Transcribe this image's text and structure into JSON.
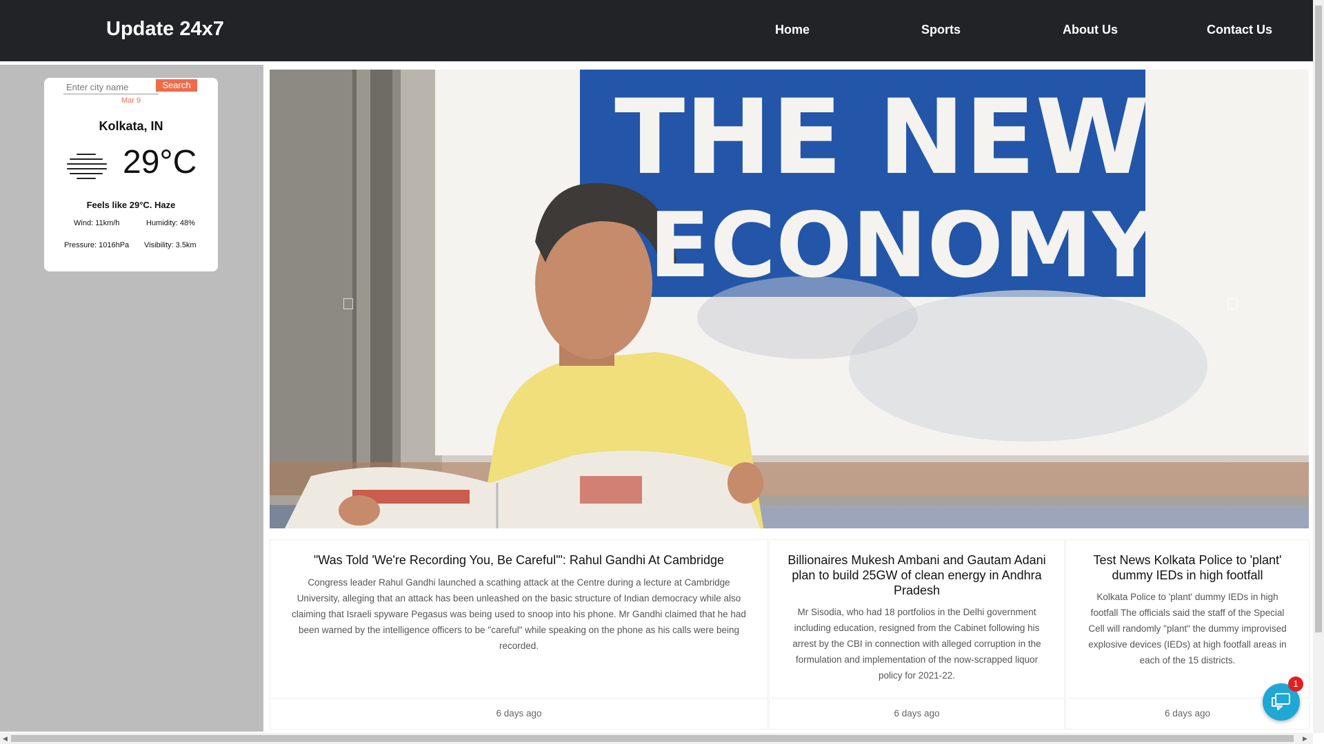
{
  "navbar": {
    "brand": "Update 24x7",
    "links": [
      "Home",
      "Sports",
      "About Us",
      "Contact Us"
    ]
  },
  "weather": {
    "placeholder": "Enter city name",
    "search_label": "Search",
    "date": "Mar 9",
    "city": "Kolkata, IN",
    "temperature": "29°C",
    "feels_like": "Feels like 29°C. Haze",
    "wind": "Wind: 11km/h",
    "humidity": "Humidity: 48%",
    "pressure": "Pressure: 1016hPa",
    "visibility": "Visibility: 3.5km",
    "icon": "haze-icon"
  },
  "hero": {
    "billboard_line1": "THE NEW",
    "billboard_line2": "ECONOMY."
  },
  "cards": [
    {
      "title": "\"Was Told 'We're Recording You, Be Careful'\": Rahul Gandhi At Cambridge",
      "text": "Congress leader Rahul Gandhi launched a scathing attack at the Centre during a lecture at Cambridge University, alleging that an attack has been unleashed on the basic structure of Indian democracy while also claiming that Israeli spyware Pegasus was being used to snoop into his phone. Mr Gandhi claimed that he had been warned by the intelligence officers to be \"careful\" while speaking on the phone as his calls were being recorded.",
      "time": "6 days ago"
    },
    {
      "title": "Billionaires Mukesh Ambani and Gautam Adani plan to build 25GW of clean energy in Andhra Pradesh",
      "text": "Mr Sisodia, who had 18 portfolios in the Delhi government including education, resigned from the Cabinet following his arrest by the CBI in connection with alleged corruption in the formulation and implementation of the now-scrapped liquor policy for 2021-22.",
      "time": "6 days ago"
    },
    {
      "title": "Test News Kolkata Police to 'plant' dummy IEDs in high footfall",
      "text": "Kolkata Police to 'plant' dummy IEDs in high footfall The officials said the staff of the Special Cell will randomly \"plant\" the dummy improvised explosive devices (IEDs) at high footfall areas in each of the 15 districts.",
      "time": "6 days ago"
    }
  ],
  "chat": {
    "badge": "1"
  },
  "colors": {
    "navbar": "#222326",
    "accent": "#ef6c4a",
    "sidebar": "#bcbcbc",
    "chat": "#1fa7d6"
  }
}
